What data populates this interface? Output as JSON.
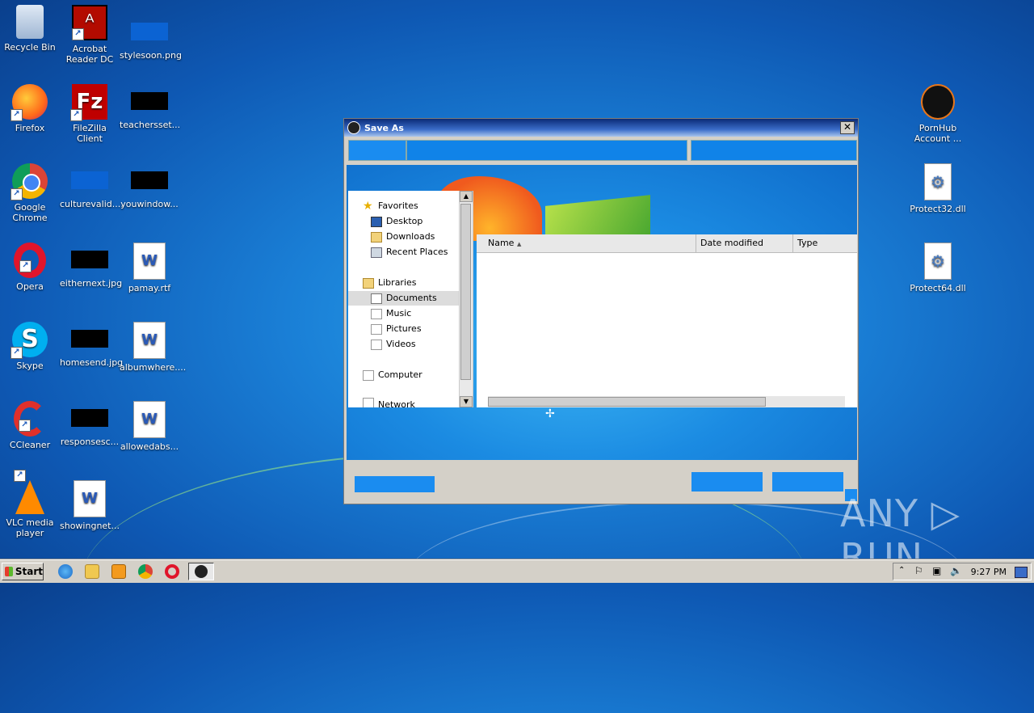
{
  "desktop": {
    "icons_col1": [
      "Recycle Bin",
      "Firefox",
      "Google Chrome",
      "Opera",
      "Skype",
      "CCleaner",
      "VLC media player"
    ],
    "icons_col2": [
      "Acrobat Reader DC",
      "FileZilla Client",
      "culturevalid....",
      "eithernext.jpg",
      "homesend.jpg",
      "responsesc...",
      "showingnet..."
    ],
    "icons_col3": [
      "stylesoon.png",
      "teachersset...",
      "youwindow...",
      "pamay.rtf",
      "albumwhere....",
      "allowedabs..."
    ],
    "icons_right": [
      "PornHub Account ...",
      "Protect32.dll",
      "Protect64.dll"
    ]
  },
  "dialog": {
    "title": "Save As",
    "close": "✕",
    "nav": {
      "favorites": "Favorites",
      "desktop": "Desktop",
      "downloads": "Downloads",
      "recent": "Recent Places",
      "libraries": "Libraries",
      "documents": "Documents",
      "music": "Music",
      "pictures": "Pictures",
      "videos": "Videos",
      "computer": "Computer",
      "network": "Network"
    },
    "columns": [
      "Name",
      "Date modified",
      "Type"
    ]
  },
  "taskbar": {
    "start": "Start",
    "clock": "9:27 PM"
  },
  "watermark": "ANY ▷ RUN",
  "colors": {
    "accent": "#1a8cf0",
    "title_bar": "#0b2a77"
  }
}
